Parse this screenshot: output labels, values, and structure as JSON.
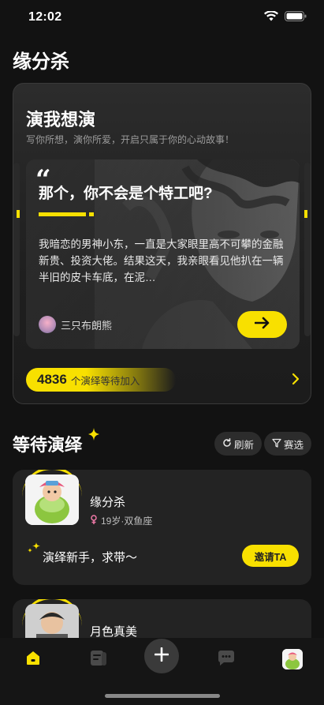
{
  "status_bar": {
    "time": "12:02"
  },
  "app": {
    "title": "缘分杀"
  },
  "hero": {
    "title": "演我想演",
    "subtitle": "写你所想，演你所爱，开启只属于你的心动故事！",
    "story": {
      "question": "那个，你不会是个特工吧?",
      "text": "我暗恋的男神小东，一直是大家眼里高不可攀的金融新贵、投资大佬。结果这天，我亲眼看见他扒在一辆半旧的皮卡车底，在泥…",
      "author": "三只布朗熊"
    },
    "waiting_count": "4836",
    "waiting_text": "个演绎等待加入"
  },
  "section": {
    "title": "等待演绎",
    "refresh_label": "刷新",
    "filter_label": "赛选"
  },
  "users": [
    {
      "name": "缘分杀",
      "meta": "19岁·双鱼座",
      "bio": "演绎新手，求带～",
      "invite_label": "邀请TA"
    },
    {
      "name": "月色真美"
    }
  ],
  "colors": {
    "accent": "#f8e000",
    "background": "#121212",
    "card": "#232323"
  },
  "icons": [
    "wifi-icon",
    "battery-icon",
    "quote-icon",
    "arrow-right-icon",
    "chevron-right-icon",
    "refresh-icon",
    "filter-icon",
    "female-icon",
    "sparkle-icon",
    "home-icon",
    "scripts-icon",
    "plus-icon",
    "chat-icon"
  ]
}
